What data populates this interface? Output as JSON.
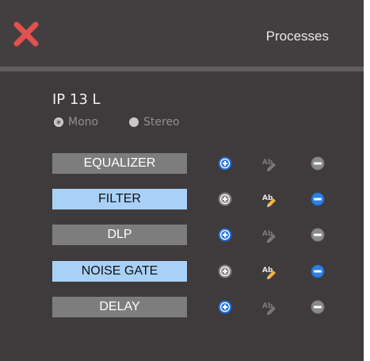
{
  "window": {
    "title": "Processes"
  },
  "channel": {
    "name": "IP 13 L"
  },
  "mode": {
    "options": [
      "Mono",
      "Stereo"
    ],
    "selected": "Mono"
  },
  "processes": [
    {
      "label": "EQUALIZER",
      "active": false
    },
    {
      "label": "FILTER",
      "active": true
    },
    {
      "label": "DLP",
      "active": false
    },
    {
      "label": "NOISE GATE",
      "active": true
    },
    {
      "label": "DELAY",
      "active": false
    }
  ],
  "icons": {
    "close": "close-x-icon",
    "add": "plus-circle-icon",
    "edit": "rename-pencil-icon",
    "remove": "minus-circle-icon"
  },
  "colors": {
    "active_button": "#a9d1f7",
    "inactive_button": "#7d7d7d",
    "icon_blue": "#2f7fe0",
    "icon_gray": "#8a8a8a",
    "close_red": "#d9534f"
  }
}
